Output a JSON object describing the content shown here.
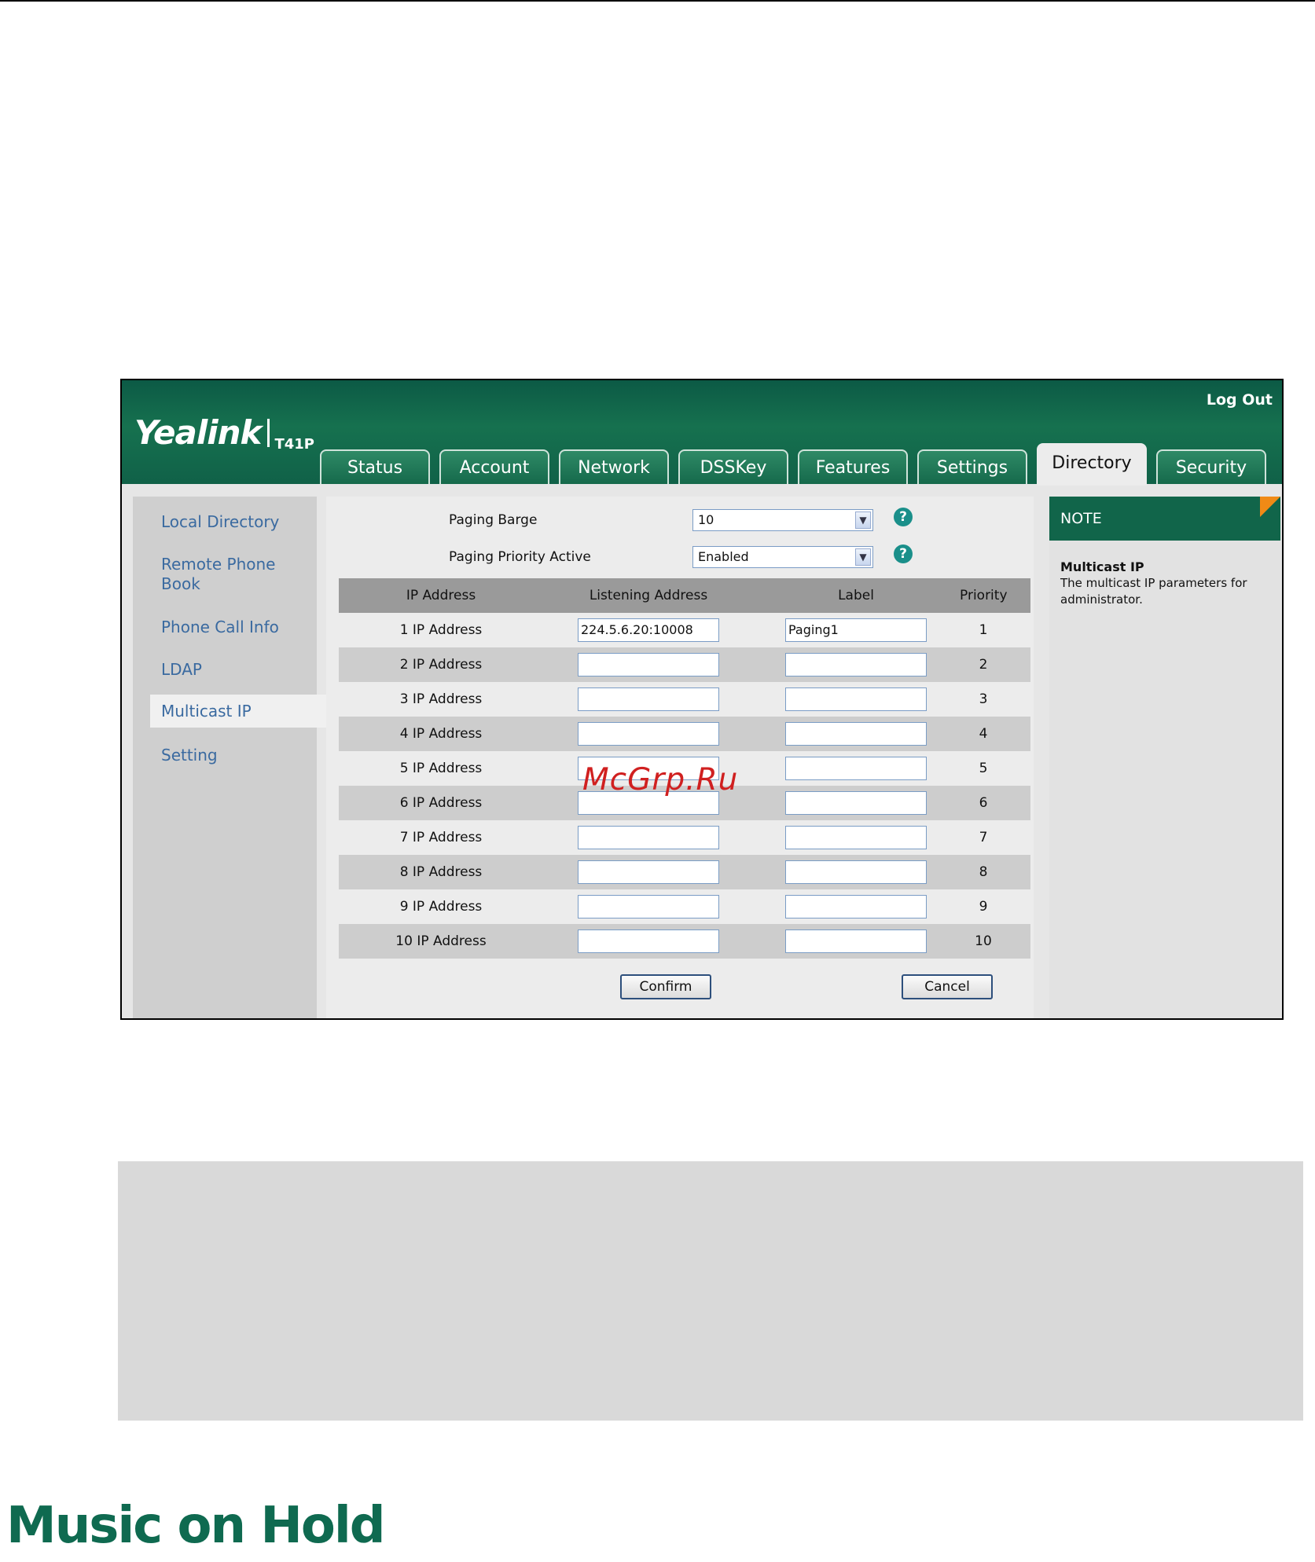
{
  "header": {
    "logout_label": "Log Out",
    "brand": "Yealink",
    "model": "T41P"
  },
  "tabs": [
    {
      "label": "Status"
    },
    {
      "label": "Account"
    },
    {
      "label": "Network"
    },
    {
      "label": "DSSKey"
    },
    {
      "label": "Features"
    },
    {
      "label": "Settings"
    },
    {
      "label": "Directory",
      "active": true
    },
    {
      "label": "Security"
    }
  ],
  "sidebar": {
    "items": [
      {
        "label": "Local Directory"
      },
      {
        "label": "Remote Phone Book"
      },
      {
        "label": "Phone Call Info"
      },
      {
        "label": "LDAP"
      },
      {
        "label": "Multicast IP",
        "active": true
      },
      {
        "label": "Setting"
      }
    ]
  },
  "form": {
    "paging_barge_label": "Paging Barge",
    "paging_barge_value": "10",
    "paging_priority_label": "Paging Priority Active",
    "paging_priority_value": "Enabled",
    "help_glyph": "?"
  },
  "table": {
    "headers": {
      "ip_address": "IP Address",
      "listening_address": "Listening Address",
      "label": "Label",
      "priority": "Priority"
    },
    "rows": [
      {
        "name": "1  IP Address",
        "address": "224.5.6.20:10008",
        "label": "Paging1",
        "priority": "1"
      },
      {
        "name": "2  IP Address",
        "address": "",
        "label": "",
        "priority": "2"
      },
      {
        "name": "3  IP Address",
        "address": "",
        "label": "",
        "priority": "3"
      },
      {
        "name": "4  IP Address",
        "address": "",
        "label": "",
        "priority": "4"
      },
      {
        "name": "5  IP Address",
        "address": "",
        "label": "",
        "priority": "5"
      },
      {
        "name": "6  IP Address",
        "address": "",
        "label": "",
        "priority": "6"
      },
      {
        "name": "7  IP Address",
        "address": "",
        "label": "",
        "priority": "7"
      },
      {
        "name": "8  IP Address",
        "address": "",
        "label": "",
        "priority": "8"
      },
      {
        "name": "9  IP Address",
        "address": "",
        "label": "",
        "priority": "9"
      },
      {
        "name": "10  IP Address",
        "address": "",
        "label": "",
        "priority": "10"
      }
    ]
  },
  "buttons": {
    "confirm": "Confirm",
    "cancel": "Cancel"
  },
  "note": {
    "header": "NOTE",
    "title": "Multicast IP",
    "text": "The multicast IP parameters for administrator."
  },
  "watermark": "McGrp.Ru",
  "section_title": "Music on Hold",
  "colors": {
    "header_green": "#106148",
    "note_green": "#11654a",
    "link_blue": "#3a6aa0",
    "corner_orange": "#f08a16",
    "title_green": "#0f6a50"
  }
}
